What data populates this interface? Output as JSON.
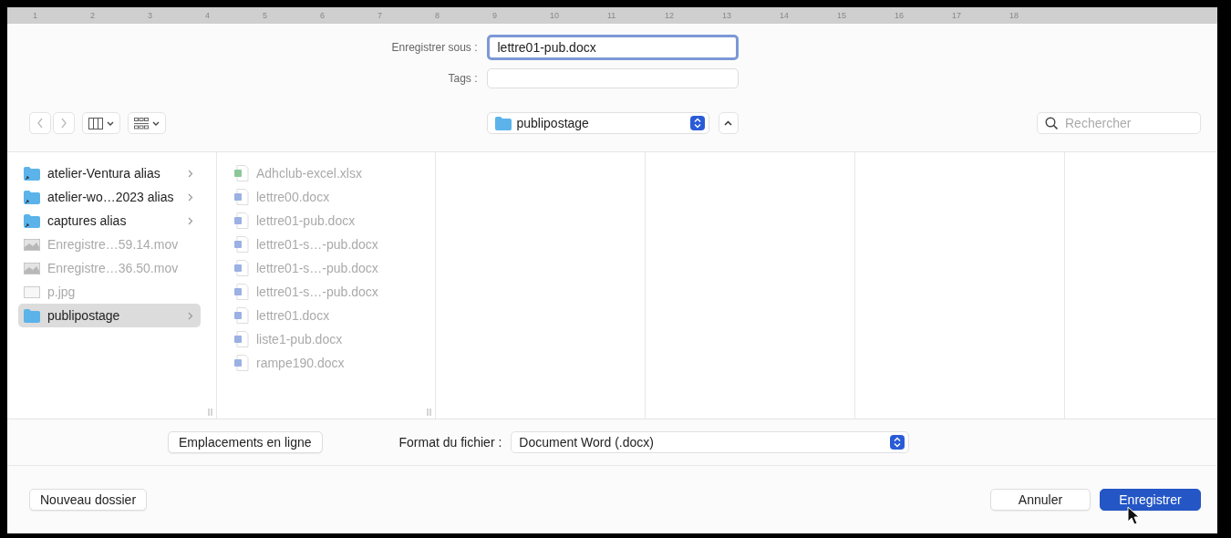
{
  "ruler": {
    "numbers": [
      "1",
      "2",
      "3",
      "4",
      "5",
      "6",
      "7",
      "8",
      "9",
      "10",
      "11",
      "12",
      "13",
      "14",
      "15",
      "16",
      "17",
      "18"
    ]
  },
  "save_as": {
    "label": "Enregistrer sous :",
    "value": "lettre01-pub.docx",
    "focused": true
  },
  "tags": {
    "label": "Tags :"
  },
  "location": {
    "label": "publipostage"
  },
  "search": {
    "placeholder": "Rechercher"
  },
  "columns": [
    {
      "items": [
        {
          "name": "atelier-Ventura alias",
          "kind": "folder-alias",
          "disabled": false,
          "selected": false,
          "expandable": true
        },
        {
          "name": "atelier-wo…2023 alias",
          "kind": "folder-alias",
          "disabled": false,
          "selected": false,
          "expandable": true
        },
        {
          "name": "captures alias",
          "kind": "folder-alias",
          "disabled": false,
          "selected": false,
          "expandable": true
        },
        {
          "name": "Enregistre…59.14.mov",
          "kind": "video",
          "disabled": true,
          "selected": false,
          "expandable": false
        },
        {
          "name": "Enregistre…36.50.mov",
          "kind": "video",
          "disabled": true,
          "selected": false,
          "expandable": false
        },
        {
          "name": "p.jpg",
          "kind": "image",
          "disabled": true,
          "selected": false,
          "expandable": false
        },
        {
          "name": "publipostage",
          "kind": "folder",
          "disabled": false,
          "selected": true,
          "expandable": true
        }
      ]
    },
    {
      "items": [
        {
          "name": "Adhclub-excel.xlsx",
          "kind": "excel",
          "disabled": true,
          "selected": false,
          "expandable": false
        },
        {
          "name": "lettre00.docx",
          "kind": "word",
          "disabled": true,
          "selected": false,
          "expandable": false
        },
        {
          "name": "lettre01-pub.docx",
          "kind": "word",
          "disabled": true,
          "selected": false,
          "expandable": false
        },
        {
          "name": "lettre01-s…-pub.docx",
          "kind": "word",
          "disabled": true,
          "selected": false,
          "expandable": false
        },
        {
          "name": "lettre01-s…-pub.docx",
          "kind": "word",
          "disabled": true,
          "selected": false,
          "expandable": false
        },
        {
          "name": "lettre01-s…-pub.docx",
          "kind": "word",
          "disabled": true,
          "selected": false,
          "expandable": false
        },
        {
          "name": "lettre01.docx",
          "kind": "word",
          "disabled": true,
          "selected": false,
          "expandable": false
        },
        {
          "name": "liste1-pub.docx",
          "kind": "word",
          "disabled": true,
          "selected": false,
          "expandable": false
        },
        {
          "name": "rampe190.docx",
          "kind": "word",
          "disabled": true,
          "selected": false,
          "expandable": false
        }
      ]
    }
  ],
  "online_button": {
    "label": "Emplacements en ligne"
  },
  "format": {
    "label": "Format du fichier :",
    "value": "Document Word (.docx)"
  },
  "buttons": [
    {
      "label": "Nouveau dossier",
      "kind": "normal"
    },
    {
      "label": "Annuler",
      "kind": "normal"
    },
    {
      "label": "Enregistrer",
      "kind": "default"
    }
  ]
}
